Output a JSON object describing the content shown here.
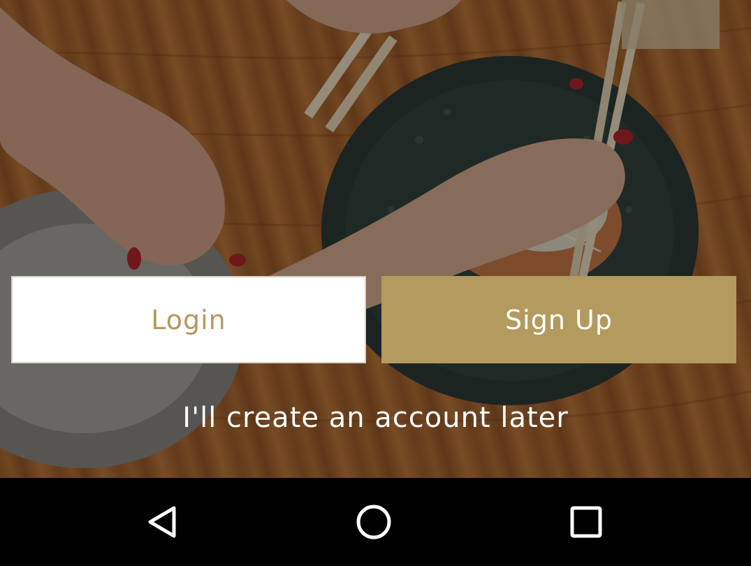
{
  "buttons": {
    "login_label": "Login",
    "signup_label": "Sign Up"
  },
  "skip_link": "I'll create an account later",
  "colors": {
    "accent": "#b39a5e",
    "login_bg": "#ffffff",
    "navbar_bg": "#000000"
  },
  "navigation_bar": {
    "icons": [
      "back-icon",
      "home-icon",
      "recents-icon"
    ]
  }
}
